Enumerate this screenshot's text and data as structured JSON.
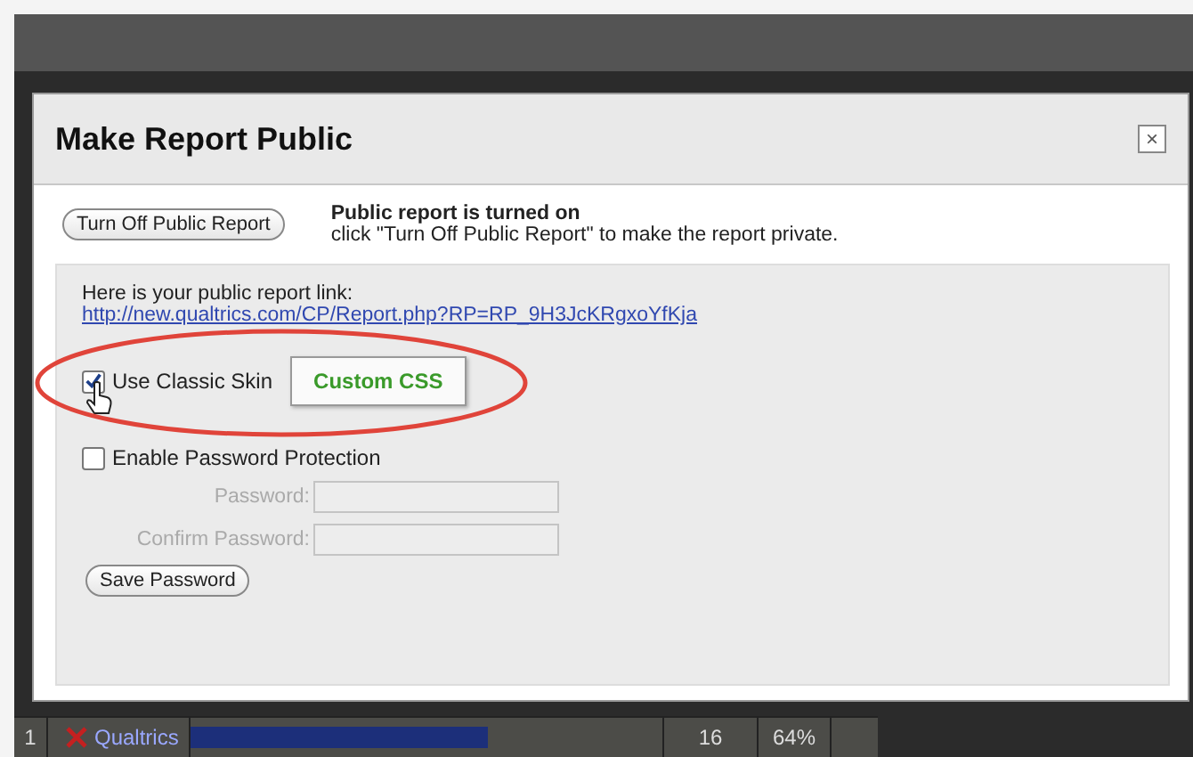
{
  "dialog": {
    "title": "Make Report Public",
    "close_label": "×"
  },
  "status": {
    "button": "Turn Off Public Report",
    "heading": "Public report is turned on",
    "message": "click \"Turn Off Public Report\" to make the report private."
  },
  "link": {
    "label": "Here is your public report link:",
    "url": "http://new.qualtrics.com/CP/Report.php?RP=RP_9H3JcKRgxoYfKja"
  },
  "classic_skin": {
    "label": "Use Classic Skin",
    "checked": true,
    "button": "Custom CSS"
  },
  "password_protection": {
    "label": "Enable Password Protection",
    "checked": false
  },
  "password_fields": [
    {
      "label": "Password:",
      "disabled": true
    },
    {
      "label": "Confirm Password:",
      "disabled": true
    }
  ],
  "save_button": "Save Password",
  "table_row": {
    "rank": "1",
    "name": "Qualtrics",
    "level": 0.63,
    "count": "16",
    "percent": "64%"
  }
}
